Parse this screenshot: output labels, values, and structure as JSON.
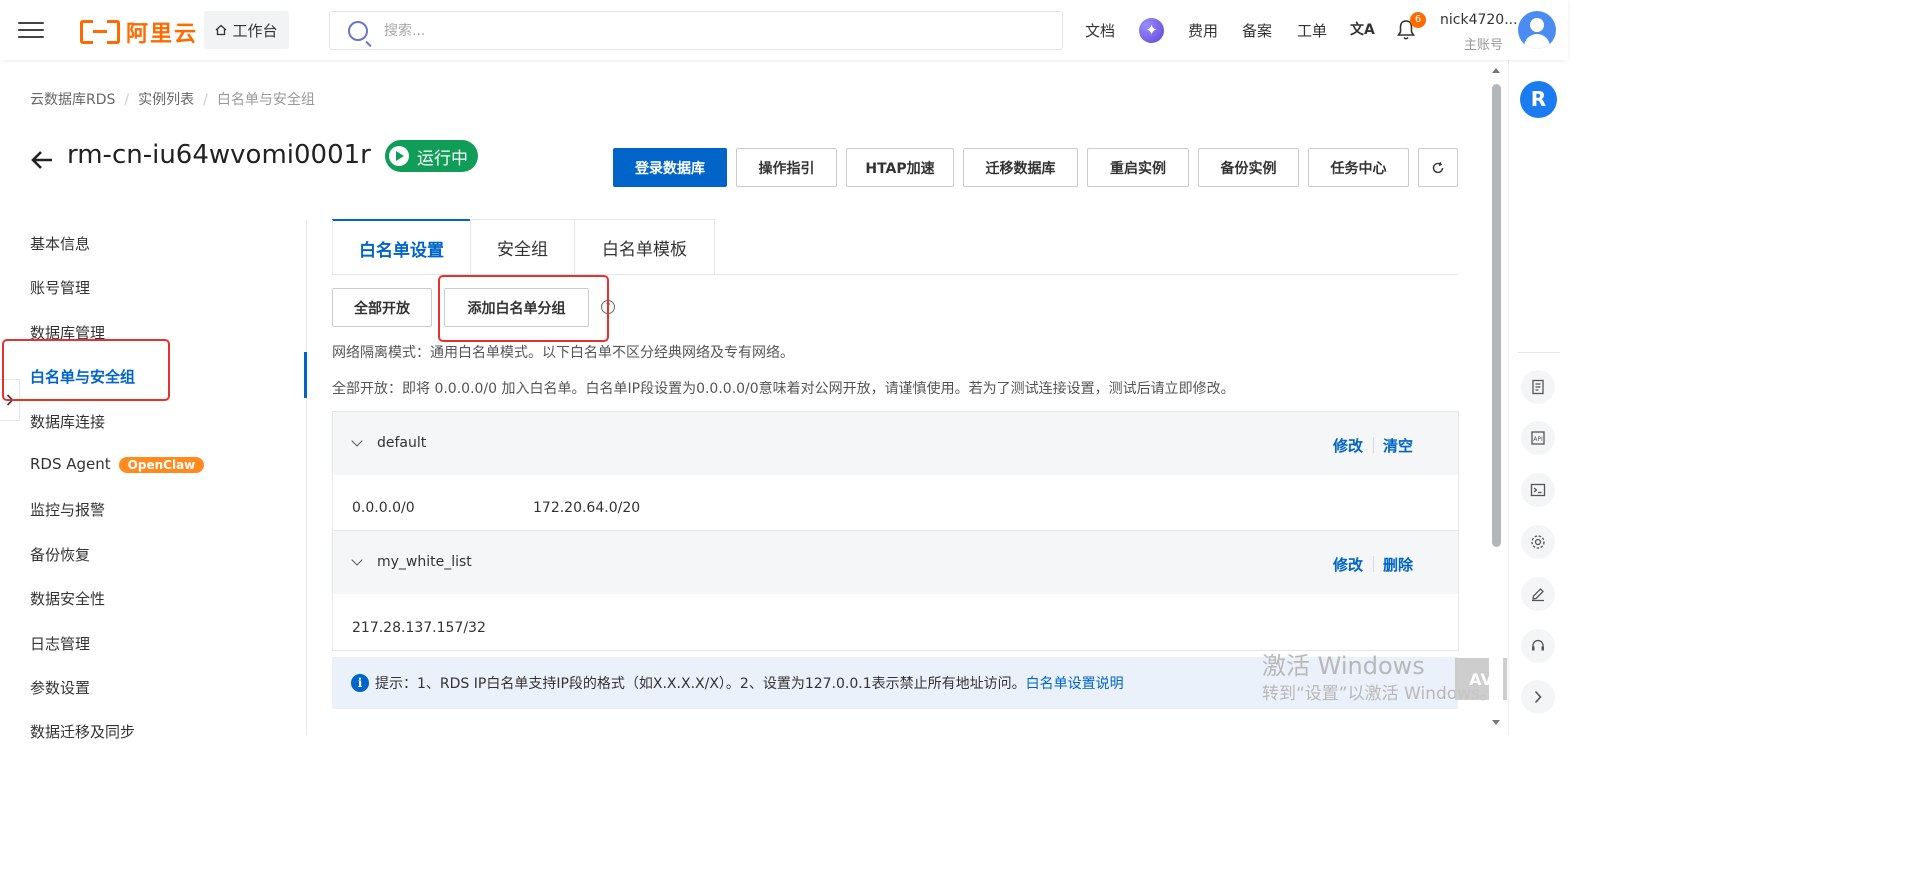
{
  "topbar": {
    "brand": "阿里云",
    "workbench": "工作台",
    "search_placeholder": "搜索...",
    "nav": [
      "文档",
      "费用",
      "备案",
      "工单"
    ],
    "lang_icon_text": "文A",
    "notification_count": "6",
    "user_name": "nick4720...",
    "user_role": "主账号"
  },
  "breadcrumb": [
    "云数据库RDS",
    "实例列表",
    "白名单与安全组"
  ],
  "instance": {
    "id": "rm-cn-iu64wvomi0001r",
    "status": "运行中"
  },
  "actions": [
    "登录数据库",
    "操作指引",
    "HTAP加速",
    "迁移数据库",
    "重启实例",
    "备份实例",
    "任务中心"
  ],
  "leftnav": {
    "items": [
      "基本信息",
      "账号管理",
      "数据库管理",
      "白名单与安全组",
      "数据库连接",
      "RDS Agent",
      "监控与报警",
      "备份恢复",
      "数据安全性",
      "日志管理",
      "参数设置",
      "数据迁移及同步"
    ],
    "openclaw_badge": "OpenClaw",
    "active_index": 3
  },
  "tabs": [
    "白名单设置",
    "安全组",
    "白名单模板"
  ],
  "buttons": {
    "open_all": "全部开放",
    "add_group": "添加白名单分组"
  },
  "notes": {
    "mode": "网络隔离模式：通用白名单模式。以下白名单不区分经典网络及专有网络。",
    "open_all": "全部开放：即将 0.0.0.0/0 加入白名单。白名单IP段设置为0.0.0.0/0意味着对公网开放，请谨慎使用。若为了测试连接设置，测试后请立即修改。"
  },
  "groups": [
    {
      "name": "default",
      "actions": [
        "修改",
        "清空"
      ],
      "ips": [
        "0.0.0.0/0",
        "172.20.64.0/20"
      ]
    },
    {
      "name": "my_white_list",
      "actions": [
        "修改",
        "删除"
      ],
      "ips": [
        "217.28.137.157/32"
      ]
    }
  ],
  "tip": {
    "text": "提示：1、RDS IP白名单支持IP段的格式（如X.X.X.X/X）。2、设置为127.0.0.1表示禁止所有地址访问。",
    "link": "白名单设置说明"
  },
  "watermark": {
    "line1": "激活 Windows",
    "line2": "转到“设置”以激活 Windows。"
  },
  "colors": {
    "accent": "#0064c8",
    "brand": "#ff6a00",
    "running": "#0f9d58",
    "highlight": "#e5322d"
  }
}
